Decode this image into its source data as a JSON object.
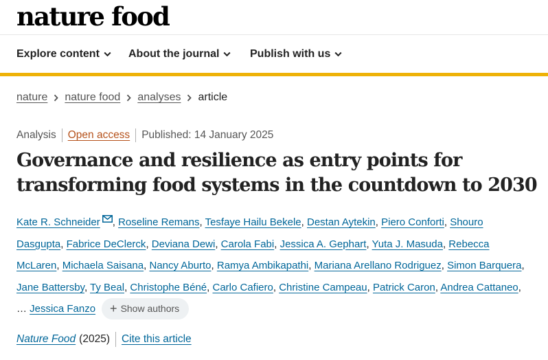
{
  "site": {
    "logo": "nature food"
  },
  "nav": [
    {
      "label": "Explore content",
      "icon": "chevron-down-icon"
    },
    {
      "label": "About the journal",
      "icon": "chevron-down-icon"
    },
    {
      "label": "Publish with us",
      "icon": "chevron-down-icon"
    }
  ],
  "colors": {
    "accent": "#eeb207",
    "link": "#006699",
    "open_access": "#b5511a"
  },
  "breadcrumb": {
    "items": [
      "nature",
      "nature food",
      "analyses"
    ],
    "current": "article",
    "separator_icon": "chevron-right-icon"
  },
  "article": {
    "type": "Analysis",
    "access": "Open access",
    "published": "Published: 14 January 2025",
    "title": "Governance and resilience as entry points for transforming food systems in the countdown to 2030"
  },
  "authors": {
    "list": [
      "Kate R. Schneider",
      "Roseline Remans",
      "Tesfaye Hailu Bekele",
      "Destan Aytekin",
      "Piero Conforti",
      "Shouro Dasgupta",
      "Fabrice DeClerck",
      "Deviana Dewi",
      "Carola Fabi",
      "Jessica A. Gephart",
      "Yuta J. Masuda",
      "Rebecca McLaren",
      "Michaela Saisana",
      "Nancy Aburto",
      "Ramya Ambikapathi",
      "Mariana Arellano Rodriguez",
      "Simon Barquera",
      "Jane Battersby",
      "Ty Beal",
      "Christophe Béné",
      "Carlo Cafiero",
      "Christine Campeau",
      "Patrick Caron",
      "Andrea Cattaneo"
    ],
    "ellipsis": "…",
    "last": "Jessica Fanzo",
    "show_label": "Show authors",
    "corresponding_icon": "mail-icon"
  },
  "citation": {
    "journal": "Nature Food",
    "year": "(2025)",
    "cite_label": "Cite this article"
  }
}
